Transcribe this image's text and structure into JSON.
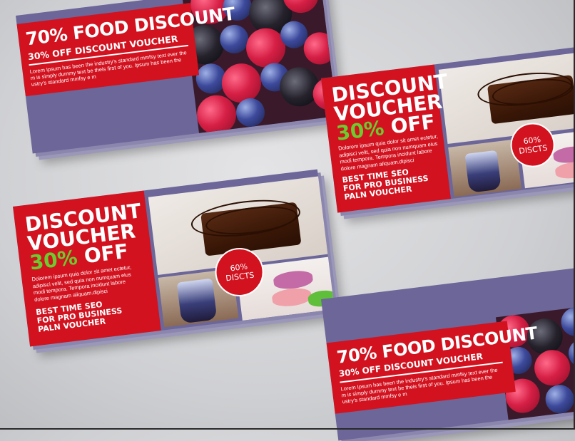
{
  "food_voucher": {
    "headline": "70% FOOD DISCOUNT",
    "subline": "30% OFF DISCOUNT VOUCHER",
    "body_lines": [
      "Lorem Ipsum has been the industry's standard mmfsy text ever  the",
      "m is simply dummy text be theis first of you.  Ipsum has been the",
      "ustry's standard mmfsy e  m"
    ]
  },
  "dessert_voucher": {
    "title_line1": "DISCOUNT",
    "title_line2": "VOUCHER",
    "percent": "30%",
    "off": "OFF",
    "body_lines": [
      "Dolorem ipsum quia dolor sit amet ectetur,",
      "adipisci velit, sed quia non numquam eius",
      "modi tempora. Tempora incidunt labore",
      "dolore magnam aliquam.dipisci"
    ],
    "tagline": [
      "BEST TIME SEO",
      "FOR PRO BUSINESS",
      "PALN VOUCHER"
    ],
    "badge_value": "60%",
    "badge_label": "DISCTS"
  },
  "colors": {
    "red": "#d2121f",
    "purple": "#6c6699",
    "green": "#6ccb2f"
  }
}
